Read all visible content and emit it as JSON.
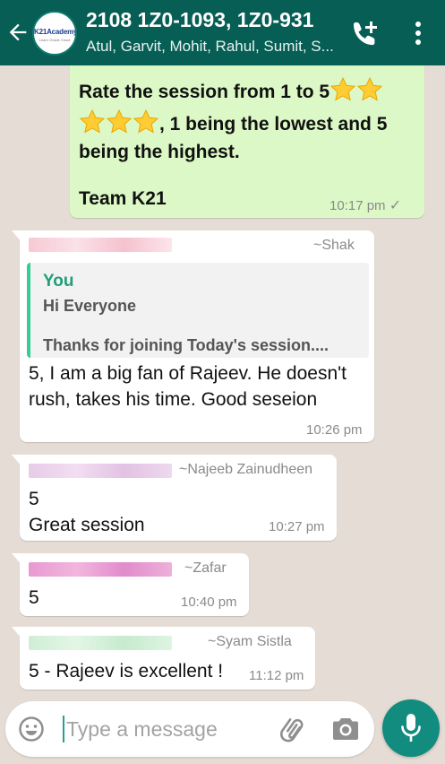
{
  "header": {
    "title": "2108 1Z0-1093, 1Z0-931",
    "members": "Atul, Garvit, Mohit, Rahul, Sumit, S...",
    "avatar_text": "K21Academy",
    "avatar_sub": "Learn Oracle Cloud",
    "back_icon": "back-arrow-icon",
    "call_icon": "add-call-icon",
    "menu_icon": "more-vert-icon"
  },
  "messages": [
    {
      "direction": "out",
      "line1": "Rate the session from 1 to 5",
      "line2": ", 1 being the lowest and 5",
      "line3": "being the highest.",
      "signature": "Team K21",
      "time": "10:17 pm",
      "tick": "✓"
    },
    {
      "direction": "in",
      "sender_name": "~Shak",
      "quote_author": "You",
      "quote_line1": "Hi Everyone",
      "quote_line2": "Thanks for joining Today's session....",
      "line1": "5, I am a big fan of Rajeev. He doesn't",
      "line2": "rush, takes his time.  Good seseion",
      "time": "10:26 pm"
    },
    {
      "direction": "in",
      "sender_name": "~Najeeb Zainudheen",
      "line1": "5",
      "line2": "Great session",
      "time": "10:27 pm"
    },
    {
      "direction": "in",
      "sender_name": "~Zafar",
      "line1": "5",
      "time": "10:40 pm"
    },
    {
      "direction": "in",
      "sender_name": "~Syam Sistla",
      "line1": "5 - Rajeev is excellent !",
      "time": "11:12 pm"
    }
  ],
  "composer": {
    "placeholder": "Type a message",
    "emoji_icon": "emoji-icon",
    "attach_icon": "paperclip-icon",
    "camera_icon": "camera-icon",
    "mic_icon": "mic-icon"
  },
  "colors": {
    "header": "#075e54",
    "outgoing_bubble": "#dcf8c6",
    "incoming_bubble": "#ffffff",
    "chat_background": "#e5ddd5",
    "mic_button": "#128c7e",
    "quote_accent": "#35cd96"
  }
}
